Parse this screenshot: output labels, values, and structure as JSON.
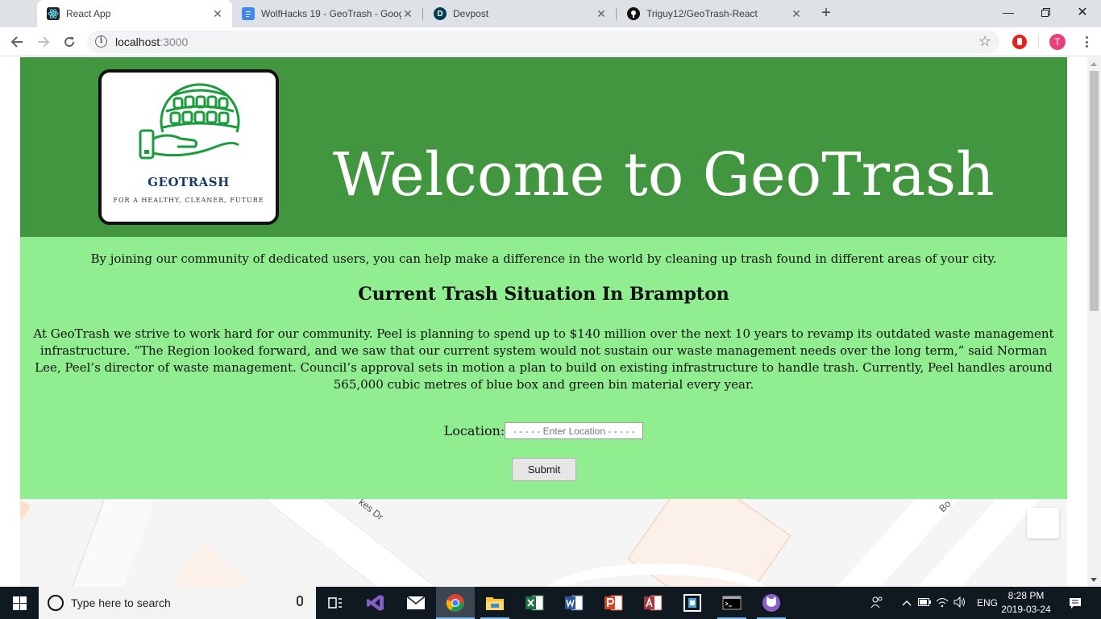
{
  "browser": {
    "tabs": [
      {
        "title": "React App",
        "active": true
      },
      {
        "title": "WolfHacks 19 - GeoTrash - Googl",
        "active": false
      },
      {
        "title": "Devpost",
        "active": false
      },
      {
        "title": "Triguy12/GeoTrash-React",
        "active": false
      }
    ],
    "url_host": "localhost",
    "url_port": ":3000",
    "profile_initial": "T"
  },
  "page": {
    "logo": {
      "brand": "GeoTrash",
      "tagline": "For a healthy, cleaner, future"
    },
    "hero_title": "Welcome to GeoTrash",
    "intro": "By joining our community of dedicated users, you can help make a difference in the world by cleaning up trash found in different areas of your city.",
    "situation_heading": "Current Trash Situation In Brampton",
    "situation_text": "At GeoTrash we strive to work hard for our community. Peel is planning to spend up to $140 million over the next 10 years to revamp its outdated waste management infrastructure. “The Region looked forward, and we saw that our current system would not sustain our waste management needs over the long term,” said Norman Lee, Peel’s director of waste management. Council’s approval sets in motion a plan to build on existing infrastructure to handle trash. Currently, Peel handles around 565,000 cubic metres of blue box and green bin material every year.",
    "location_label": "Location:",
    "location_placeholder": "- - - - - Enter Location - - - - -",
    "submit_label": "Submit",
    "map_labels": {
      "street1": "kes Dr",
      "street2": "Bo"
    }
  },
  "taskbar": {
    "search_placeholder": "Type here to search",
    "language": "ENG",
    "time": "8:28 PM",
    "date": "2019-03-24"
  },
  "colors": {
    "header_green": "#41963f",
    "content_green": "#90ee90",
    "logo_green": "#1a9b3c"
  }
}
